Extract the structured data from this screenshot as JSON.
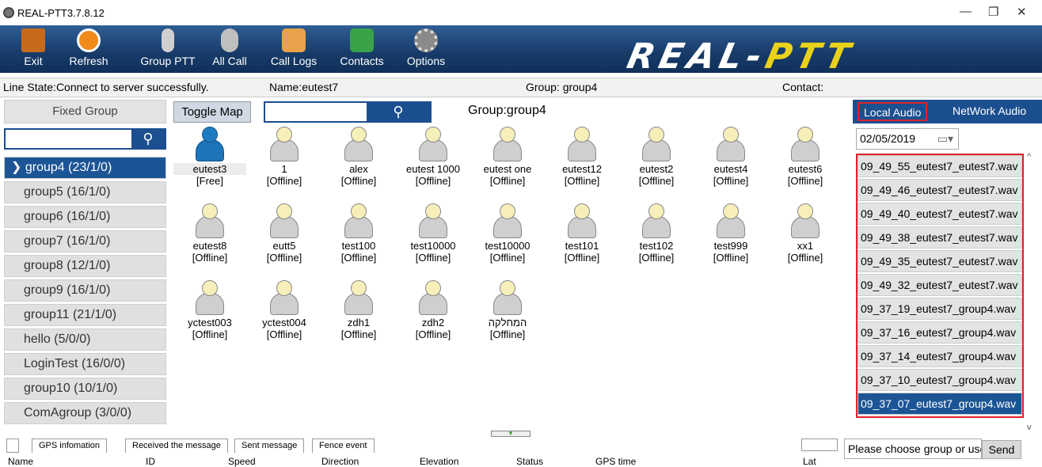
{
  "window": {
    "title": "REAL-PTT3.7.8.12",
    "minimize": "—",
    "restore": "❐",
    "close": "✕"
  },
  "toolbar": {
    "buttons": [
      {
        "label": "Exit",
        "icon": "exit-door-icon",
        "color": "#c76a1c"
      },
      {
        "label": "Refresh",
        "icon": "refresh-icon",
        "color": "#f08a1a"
      },
      {
        "label": "Group PTT",
        "icon": "microphone-icon",
        "color": "#cfcfcf"
      },
      {
        "label": "All Call",
        "icon": "broadcast-icon",
        "color": "#bfbfbf"
      },
      {
        "label": "Call Logs",
        "icon": "call-logs-icon",
        "color": "#e8a24a"
      },
      {
        "label": "Contacts",
        "icon": "contacts-icon",
        "color": "#3aa34a"
      },
      {
        "label": "Options",
        "icon": "gear-icon",
        "color": "#8a8a8a"
      }
    ],
    "logo_main": "REAL-",
    "logo_accent": "PTT"
  },
  "status": {
    "line_state": "Line State:Connect to server successfully.",
    "name": "Name:eutest7",
    "group": "Group: group4",
    "contact": "Contact:"
  },
  "left": {
    "header": "Fixed Group",
    "search_placeholder": "",
    "groups": [
      "group4 (23/1/0)",
      "group5 (16/1/0)",
      "group6 (16/1/0)",
      "group7 (16/1/0)",
      "group8 (12/1/0)",
      "group9 (16/1/0)",
      "group11 (21/1/0)",
      "hello (5/0/0)",
      "LoginTest (16/0/0)",
      "group10 (10/1/0)",
      "ComAgroup (3/0/0)"
    ]
  },
  "center": {
    "toggle_map": "Toggle Map",
    "group_label": "Group:group4",
    "users": [
      {
        "name": "eutest3",
        "status": "[Free]"
      },
      {
        "name": "1",
        "status": "[Offline]"
      },
      {
        "name": "alex",
        "status": "[Offline]"
      },
      {
        "name": "eutest 1000",
        "status": "[Offline]"
      },
      {
        "name": "eutest one",
        "status": "[Offline]"
      },
      {
        "name": "eutest12",
        "status": "[Offline]"
      },
      {
        "name": "eutest2",
        "status": "[Offline]"
      },
      {
        "name": "eutest4",
        "status": "[Offline]"
      },
      {
        "name": "eutest6",
        "status": "[Offline]"
      },
      {
        "name": "eutest8",
        "status": "[Offline]"
      },
      {
        "name": "eutt5",
        "status": "[Offline]"
      },
      {
        "name": "test100",
        "status": "[Offline]"
      },
      {
        "name": "test10000",
        "status": "[Offline]"
      },
      {
        "name": "test10000",
        "status": "[Offline]"
      },
      {
        "name": "test101",
        "status": "[Offline]"
      },
      {
        "name": "test102",
        "status": "[Offline]"
      },
      {
        "name": "test999",
        "status": "[Offline]"
      },
      {
        "name": "xx1",
        "status": "[Offline]"
      },
      {
        "name": "yctest003",
        "status": "[Offline]"
      },
      {
        "name": "yctest004",
        "status": "[Offline]"
      },
      {
        "name": "zdh1",
        "status": "[Offline]"
      },
      {
        "name": "zdh2",
        "status": "[Offline]"
      },
      {
        "name": "המחלקה",
        "status": "[Offline]"
      }
    ]
  },
  "right": {
    "tab_local": "Local Audio",
    "tab_network": "NetWork Audio",
    "date": "02/05/2019",
    "files": [
      "09_49_55_eutest7_eutest7.wav",
      "09_49_46_eutest7_eutest7.wav",
      "09_49_40_eutest7_eutest7.wav",
      "09_49_38_eutest7_eutest7.wav",
      "09_49_35_eutest7_eutest7.wav",
      "09_49_32_eutest7_eutest7.wav",
      "09_37_19_eutest7_group4.wav",
      "09_37_16_eutest7_group4.wav",
      "09_37_14_eutest7_group4.wav",
      "09_37_10_eutest7_group4.wav",
      "09_37_07_eutest7_group4.wav"
    ]
  },
  "bottom": {
    "tabs": [
      "GPS infomation",
      "Received the message",
      "Sent message",
      "Fence event"
    ],
    "columns": [
      "Name",
      "ID",
      "Speed",
      "Direction",
      "Elevation",
      "Status",
      "GPS time",
      "Lat"
    ],
    "chat_placeholder": "Please choose group or user",
    "send": "Send"
  }
}
